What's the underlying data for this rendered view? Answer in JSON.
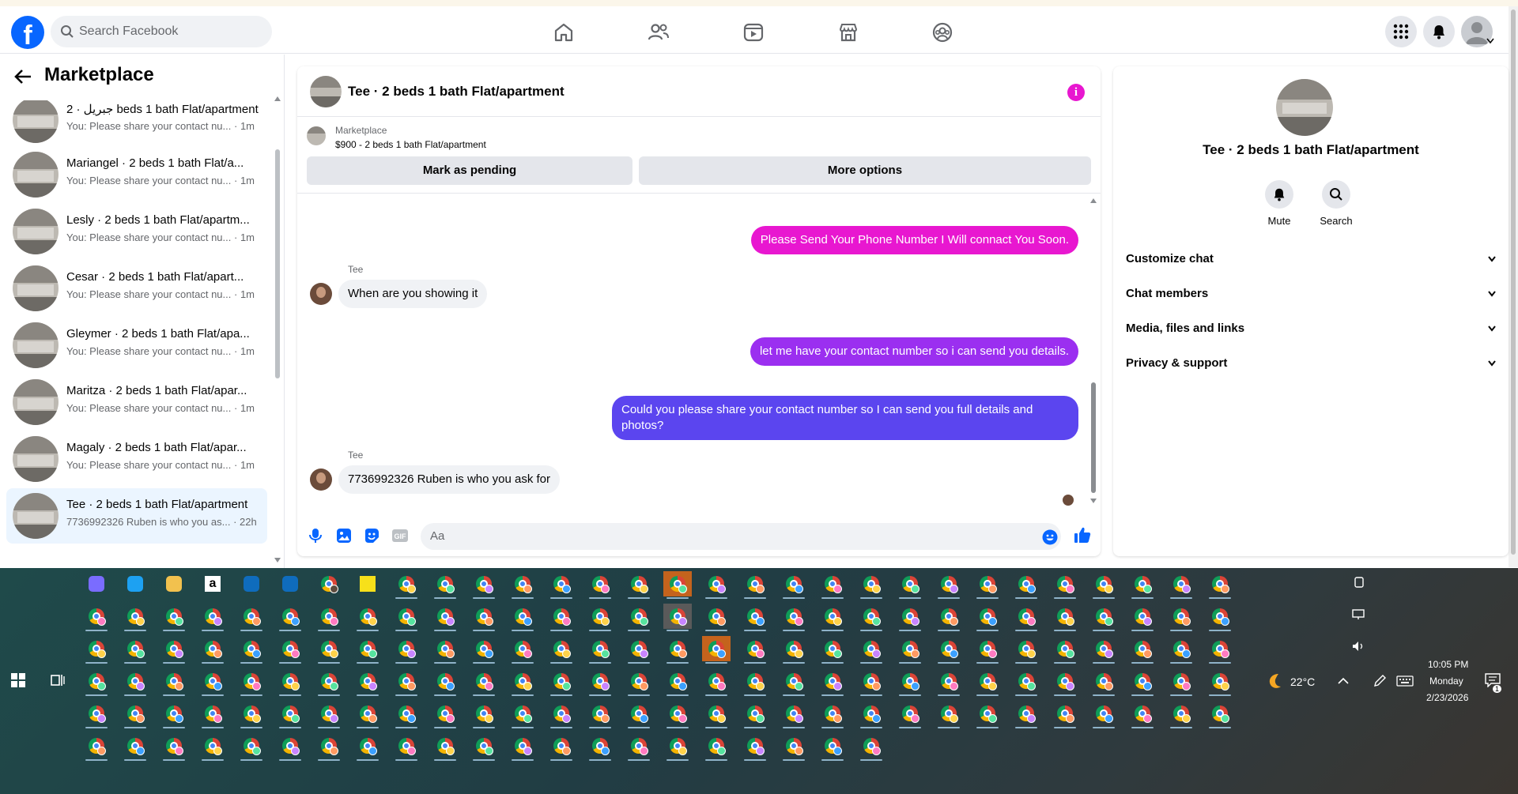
{
  "header": {
    "logo": "f",
    "search_placeholder": "Search Facebook",
    "nav_icons": [
      "home-icon",
      "friends-icon",
      "video-icon",
      "marketplace-icon",
      "groups-icon"
    ],
    "right_icons": [
      "menu-grid-icon",
      "bell-icon",
      "account-avatar"
    ]
  },
  "left": {
    "title": "Marketplace",
    "conversations": [
      {
        "name": "جبريل · 2 beds 1 bath Flat/apartment",
        "snippet": "You: Please share your contact nu...",
        "time": "· 1m"
      },
      {
        "name": "Mariangel · 2 beds 1 bath Flat/a...",
        "snippet": "You: Please share your contact nu...",
        "time": "· 1m"
      },
      {
        "name": "Lesly · 2 beds 1 bath Flat/apartm...",
        "snippet": "You: Please share your contact nu...",
        "time": "· 1m"
      },
      {
        "name": "Cesar · 2 beds 1 bath Flat/apart...",
        "snippet": "You: Please share your contact nu...",
        "time": "· 1m"
      },
      {
        "name": "Gleymer · 2 beds 1 bath Flat/apa...",
        "snippet": "You: Please share your contact nu...",
        "time": "· 1m"
      },
      {
        "name": "Maritza · 2 beds 1 bath Flat/apar...",
        "snippet": "You: Please share your contact nu...",
        "time": "· 1m"
      },
      {
        "name": "Magaly · 2 beds 1 bath Flat/apar...",
        "snippet": "You: Please share your contact nu...",
        "time": "· 1m"
      },
      {
        "name": "Tee · 2 beds 1 bath Flat/apartment",
        "snippet": "7736992326 Ruben is who you as...",
        "time": "· 22h"
      }
    ]
  },
  "chat": {
    "title": "Tee · 2 beds 1 bath Flat/apartment",
    "marketplace_label": "Marketplace",
    "listing": "$900 - 2 beds 1 bath Flat/apartment",
    "mark_pending": "Mark as pending",
    "more_options": "More options",
    "messages": [
      {
        "from": "me",
        "text": "Please Send Your Phone Number I Will connact You Soon."
      },
      {
        "from": "Tee",
        "text": "When are you showing it"
      },
      {
        "from": "me",
        "text": "let me have your contact number so i can send you details."
      },
      {
        "from": "me",
        "text": "Could you please share your contact number so I can send you full details and photos?"
      },
      {
        "from": "Tee",
        "text": "7736992326 Ruben  is who you ask for"
      }
    ],
    "input_placeholder": "Aa"
  },
  "details": {
    "name": "Tee · 2 beds 1 bath Flat/apartment",
    "mute": "Mute",
    "search": "Search",
    "rows": [
      "Customize chat",
      "Chat members",
      "Media, files and links",
      "Privacy & support"
    ]
  },
  "taskbar": {
    "weather": "22°C",
    "time": "10:05 PM",
    "day": "Monday",
    "date": "2/23/2026",
    "notification_count": "1"
  },
  "colors": {
    "accent": "#0866ff",
    "bubble1": "#e817d0",
    "bubble2": "#9b2ff0",
    "bubble3": "#5b45ef"
  }
}
